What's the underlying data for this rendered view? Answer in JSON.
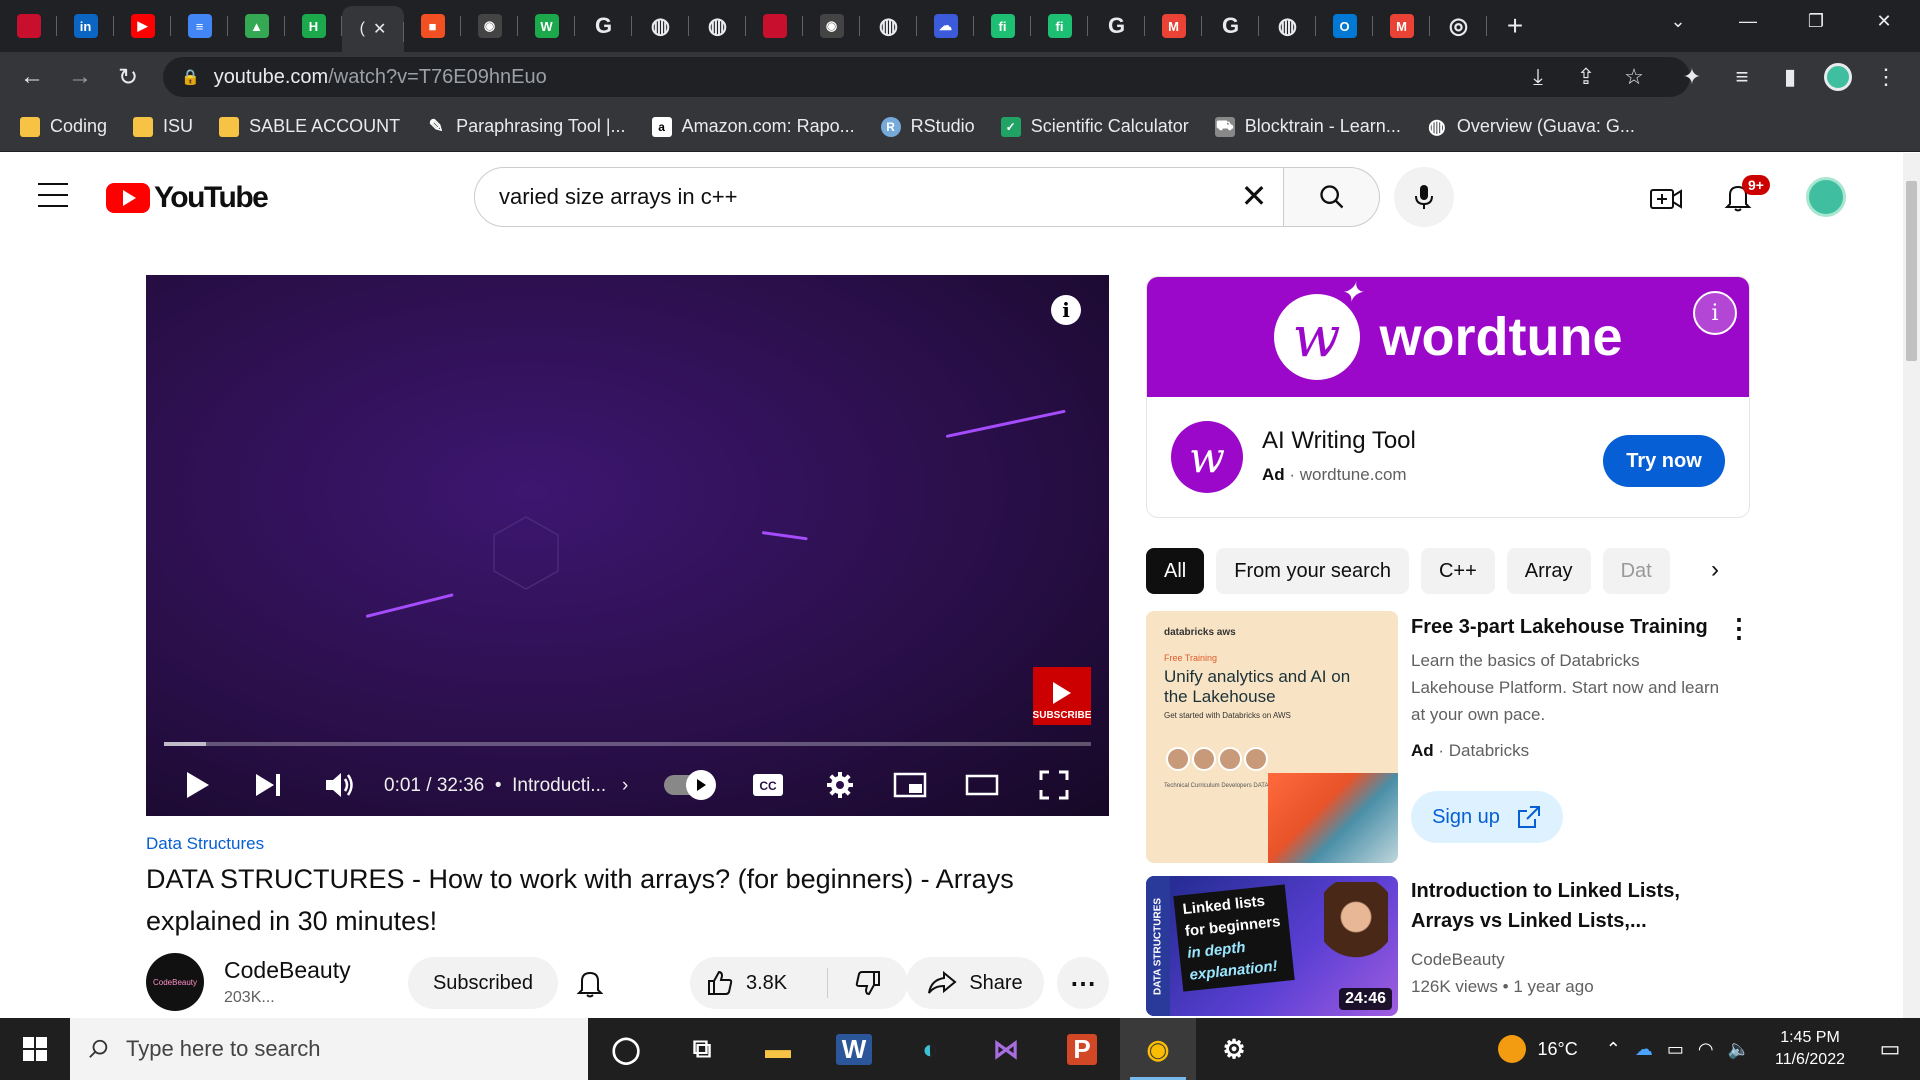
{
  "browser": {
    "tabs": [
      {
        "icon": "cardinal-icon",
        "color": "#c8102e",
        "label": ""
      },
      {
        "icon": "linkedin-icon",
        "color": "#0a66c2",
        "label": "in"
      },
      {
        "icon": "youtube-icon",
        "color": "#ff0000",
        "label": "▶"
      },
      {
        "icon": "google-docs-icon",
        "color": "#4285f4",
        "label": "≡"
      },
      {
        "icon": "google-drive-icon",
        "color": "#34a853",
        "label": "▲"
      },
      {
        "icon": "hackerrank-icon",
        "color": "#1ba94c",
        "label": "H"
      },
      {
        "icon": "microsoft-icon",
        "color": "#f25022",
        "label": "■"
      },
      {
        "icon": "github-icon",
        "color": "#444",
        "label": "◉"
      },
      {
        "icon": "wordtune-w-icon",
        "color": "#1ba94c",
        "label": "W"
      },
      {
        "icon": "google-icon",
        "color": "#fff",
        "label": "G"
      },
      {
        "icon": "globe-icon",
        "color": "#fff",
        "label": "◍"
      },
      {
        "icon": "globe-icon",
        "color": "#fff",
        "label": "◍"
      },
      {
        "icon": "cardinal-icon",
        "color": "#c8102e",
        "label": ""
      },
      {
        "icon": "github-icon",
        "color": "#444",
        "label": "◉"
      },
      {
        "icon": "globe-icon",
        "color": "#fff",
        "label": "◍"
      },
      {
        "icon": "cloud-icon",
        "color": "#3b5bdb",
        "label": "☁"
      },
      {
        "icon": "fiverr-icon",
        "color": "#1dbf73",
        "label": "fi"
      },
      {
        "icon": "fiverr-icon",
        "color": "#1dbf73",
        "label": "fi"
      },
      {
        "icon": "google-icon",
        "color": "#fff",
        "label": "G"
      },
      {
        "icon": "gmail-icon",
        "color": "#ea4335",
        "label": "M"
      },
      {
        "icon": "google-icon",
        "color": "#fff",
        "label": "G"
      },
      {
        "icon": "globe-icon",
        "color": "#fff",
        "label": "◍"
      },
      {
        "icon": "outlook-icon",
        "color": "#0078d4",
        "label": "O"
      },
      {
        "icon": "gmail-icon",
        "color": "#ea4335",
        "label": "M"
      },
      {
        "icon": "chrome-icon",
        "color": "#fff",
        "label": "◎"
      }
    ],
    "active_tab_label": "(",
    "url_host": "youtube.com",
    "url_path": "/watch?v=T76E09hnEuo",
    "bookmarks": [
      {
        "label": "Coding",
        "icon": "folder-icon",
        "color": "#f6c344"
      },
      {
        "label": "ISU",
        "icon": "folder-icon",
        "color": "#f6c344"
      },
      {
        "label": "SABLE ACCOUNT",
        "icon": "folder-icon",
        "color": "#f6c344"
      },
      {
        "label": "Paraphrasing Tool |...",
        "icon": "quill-icon",
        "color": "#35363a"
      },
      {
        "label": "Amazon.com: Rapo...",
        "icon": "amazon-icon",
        "color": "#ffffff"
      },
      {
        "label": "RStudio",
        "icon": "rstudio-icon",
        "color": "#75aadb"
      },
      {
        "label": "Scientific Calculator",
        "icon": "calculator-icon",
        "color": "#21a366"
      },
      {
        "label": "Blocktrain - Learn...",
        "icon": "blocktrain-icon",
        "color": "#888888"
      },
      {
        "label": "Overview (Guava: G...",
        "icon": "globe-icon",
        "color": "#35363a"
      }
    ]
  },
  "youtube": {
    "logo_text": "YouTube",
    "search_query": "varied size arrays in c++",
    "notification_count": "9+"
  },
  "video": {
    "time": "0:01 / 32:36",
    "chapter": "Introducti...",
    "watermark": "SUBSCRIBE",
    "progress_fraction": 0.045,
    "category": "Data Structures",
    "title": "DATA STRUCTURES - How to work with arrays? (for beginners) - Arrays explained in 30 minutes!",
    "channel_name": "CodeBeauty",
    "channel_subs": "203K...",
    "channel_avatar_text": "CodeBeauty",
    "subscribed_label": "Subscribed",
    "likes": "3.8K",
    "share_label": "Share"
  },
  "ad": {
    "brand": "wordtune",
    "title": "AI Writing Tool",
    "ad_label": "Ad",
    "domain": "wordtune.com",
    "cta": "Try now"
  },
  "chips": [
    {
      "label": "All",
      "active": true
    },
    {
      "label": "From your search",
      "active": false
    },
    {
      "label": "C++",
      "active": false
    },
    {
      "label": "Array",
      "active": false
    },
    {
      "label": "Dat",
      "active": false
    }
  ],
  "recommendations": {
    "promo": {
      "title": "Free 3-part Lakehouse Training",
      "description": "Learn the basics of Databricks Lakehouse Platform. Start now and learn at your own pace.",
      "ad_label": "Ad",
      "advertiser": "Databricks",
      "cta": "Sign up",
      "thumb_brand": "databricks   aws",
      "thumb_free": "Free Training",
      "thumb_headline": "Unify analytics and AI on the Lakehouse",
      "thumb_sub": "Get started with Databricks on AWS",
      "thumb_footer": "Technical Curriculum Developers DATABRICKS"
    },
    "video": {
      "title": "Introduction to Linked Lists, Arrays vs Linked Lists,...",
      "channel": "CodeBeauty",
      "stats": "126K views  • 1 year ago",
      "duration": "24:46",
      "thumb_side": "DATA STRUCTURES",
      "thumb_line1": "Linked lists",
      "thumb_line2": "for beginners",
      "thumb_line3": "in depth",
      "thumb_line4": "explanation!"
    }
  },
  "taskbar": {
    "search_placeholder": "Type here to search",
    "apps": [
      {
        "icon": "task-view-icon",
        "active": false
      },
      {
        "icon": "task-switcher-icon",
        "active": false
      },
      {
        "icon": "file-explorer-icon",
        "active": false
      },
      {
        "icon": "word-icon",
        "active": false
      },
      {
        "icon": "edge-icon",
        "active": false
      },
      {
        "icon": "visual-studio-icon",
        "active": false
      },
      {
        "icon": "powerpoint-icon",
        "active": false
      },
      {
        "icon": "chrome-icon",
        "active": true
      },
      {
        "icon": "settings-icon",
        "active": false
      }
    ],
    "temperature": "16°C",
    "time": "1:45 PM",
    "date": "11/6/2022"
  }
}
